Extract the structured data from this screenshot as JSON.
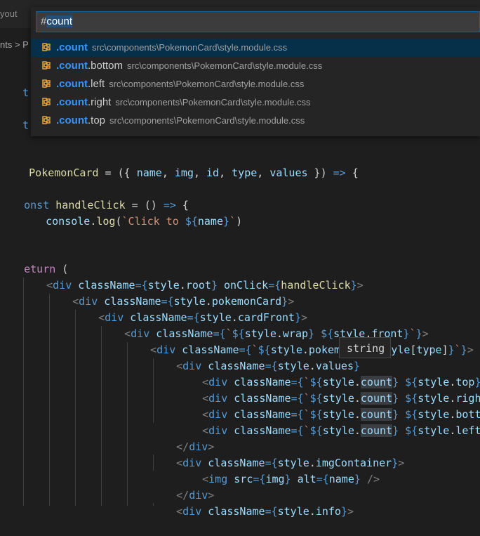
{
  "tab": {
    "fragment": "yout"
  },
  "breadcrumb": {
    "fragment": "nts > P"
  },
  "quick_open": {
    "prefix": "#",
    "selected": "count",
    "items": [
      {
        "match": ".count",
        "rest": "",
        "path": "src\\components\\PokemonCard\\style.module.css",
        "active": true
      },
      {
        "match": ".count",
        "rest": ".bottom",
        "path": "src\\components\\PokemonCard\\style.module.css",
        "active": false
      },
      {
        "match": ".count",
        "rest": ".left",
        "path": "src\\components\\PokemonCard\\style.module.css",
        "active": false
      },
      {
        "match": ".count",
        "rest": ".right",
        "path": "src\\components\\PokemonCard\\style.module.css",
        "active": false
      },
      {
        "match": ".count",
        "rest": ".top",
        "path": "src\\components\\PokemonCard\\style.module.css",
        "active": false
      }
    ],
    "icon": "symbol-class-icon",
    "icon_color": "#e8a33d"
  },
  "tooltip": {
    "text": "string"
  },
  "code": {
    "l1": [
      "t sty"
    ],
    "l2": [
      "t car"
    ],
    "l3": [
      " PokemonCard",
      " = ({ ",
      "name",
      ", ",
      "img",
      ", ",
      "id",
      ", ",
      "type",
      ", ",
      "values",
      " }) ",
      "=>",
      " {"
    ],
    "l4": [
      "onst",
      " ",
      "handleClick",
      " = () ",
      "=>",
      " {"
    ],
    "l5": [
      "console",
      ".",
      "log",
      "(",
      "`Click to ",
      "${",
      "name",
      "}",
      "`",
      ")"
    ],
    "l6": [
      "eturn",
      " ("
    ],
    "l7": [
      "<",
      "div",
      " ",
      "className",
      "={",
      "style",
      ".",
      "root",
      "} ",
      "onClick",
      "={",
      "handleClick",
      "}",
      ">"
    ],
    "l8": [
      "<",
      "div",
      " ",
      "className",
      "={",
      "style",
      ".",
      "pokemonCard",
      "}",
      ">"
    ],
    "l9": [
      "<",
      "div",
      " ",
      "className",
      "={",
      "style",
      ".",
      "cardFront",
      "}",
      ">"
    ],
    "l10": [
      "<",
      "div",
      " ",
      "className",
      "={",
      "`",
      "${",
      "style",
      ".",
      "wrap",
      "} ",
      "${",
      "style",
      ".",
      "front",
      "}",
      "`",
      "}",
      ">"
    ],
    "l11": [
      "<",
      "div",
      " ",
      "className",
      "={",
      "`",
      "${",
      "style",
      ".",
      "pokemon",
      "} ",
      "${",
      "style",
      "[",
      "type",
      "]",
      "}",
      "`",
      "}",
      ">"
    ],
    "l12": [
      "<",
      "div",
      " ",
      "className",
      "={",
      "style",
      ".",
      "values",
      "}"
    ],
    "l13": [
      "<",
      "div",
      " ",
      "className",
      "={",
      "`",
      "${",
      "style",
      ".",
      "count",
      "} ",
      "${",
      "style",
      ".",
      "top",
      "}",
      "`",
      "}",
      ">"
    ],
    "l14": [
      "<",
      "div",
      " ",
      "className",
      "={",
      "`",
      "${",
      "style",
      ".",
      "count",
      "} ",
      "${",
      "style",
      ".",
      "right",
      "}",
      "`"
    ],
    "l15": [
      "<",
      "div",
      " ",
      "className",
      "={",
      "`",
      "${",
      "style",
      ".",
      "count",
      "} ",
      "${",
      "style",
      ".",
      "bottom",
      "}"
    ],
    "l16": [
      "<",
      "div",
      " ",
      "className",
      "={",
      "`",
      "${",
      "style",
      ".",
      "count",
      "} ",
      "${",
      "style",
      ".",
      "left",
      "}",
      "`",
      "}"
    ],
    "l17": [
      "</",
      "div",
      ">"
    ],
    "l18": [
      "<",
      "div",
      " ",
      "className",
      "={",
      "style",
      ".",
      "imgContainer",
      "}",
      ">"
    ],
    "l19": [
      "<",
      "img",
      " ",
      "src",
      "={",
      "img",
      "} ",
      "alt",
      "={",
      "name",
      "} ",
      "/>"
    ],
    "l20": [
      "</",
      "div",
      ">"
    ],
    "l21": [
      "<",
      "div",
      " ",
      "className",
      "={",
      "style",
      ".",
      "info",
      "}",
      ">"
    ]
  }
}
